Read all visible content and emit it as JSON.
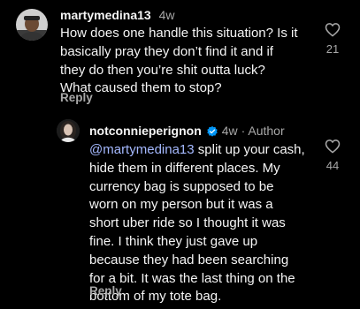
{
  "comments": [
    {
      "username": "martymedina13",
      "time": "4w",
      "lines": [
        "How does one handle this situation? Is it",
        "basically pray they don’t find it and if",
        "they do then you’re shit outta luck?",
        "What caused them to stop?"
      ],
      "reply_label": "Reply",
      "like_icon": "heart-outline-icon",
      "like_count": "21"
    },
    {
      "username": "notconnieperignon",
      "verified_icon": "verified-badge-icon",
      "time": "4w",
      "separator": "·",
      "author_label": "Author",
      "mention": "@martymedina13",
      "first_line_rest": " split up your cash,",
      "lines": [
        "hide them in different places. My",
        "currency bag is supposed to be",
        "worn on my person but it was a",
        "short uber ride so I thought it was",
        "fine. I think they just gave up",
        "because they had been searching",
        "for a bit. It was the last thing on the",
        "bottom of my tote bag."
      ],
      "reply_label": "Reply",
      "like_icon": "heart-outline-icon",
      "like_count": "44"
    }
  ],
  "colors": {
    "background": "#000000",
    "text": "#f5f5f5",
    "secondary": "#a8a8a8",
    "mention": "#a5b9ff",
    "verified": "#0095f6"
  }
}
